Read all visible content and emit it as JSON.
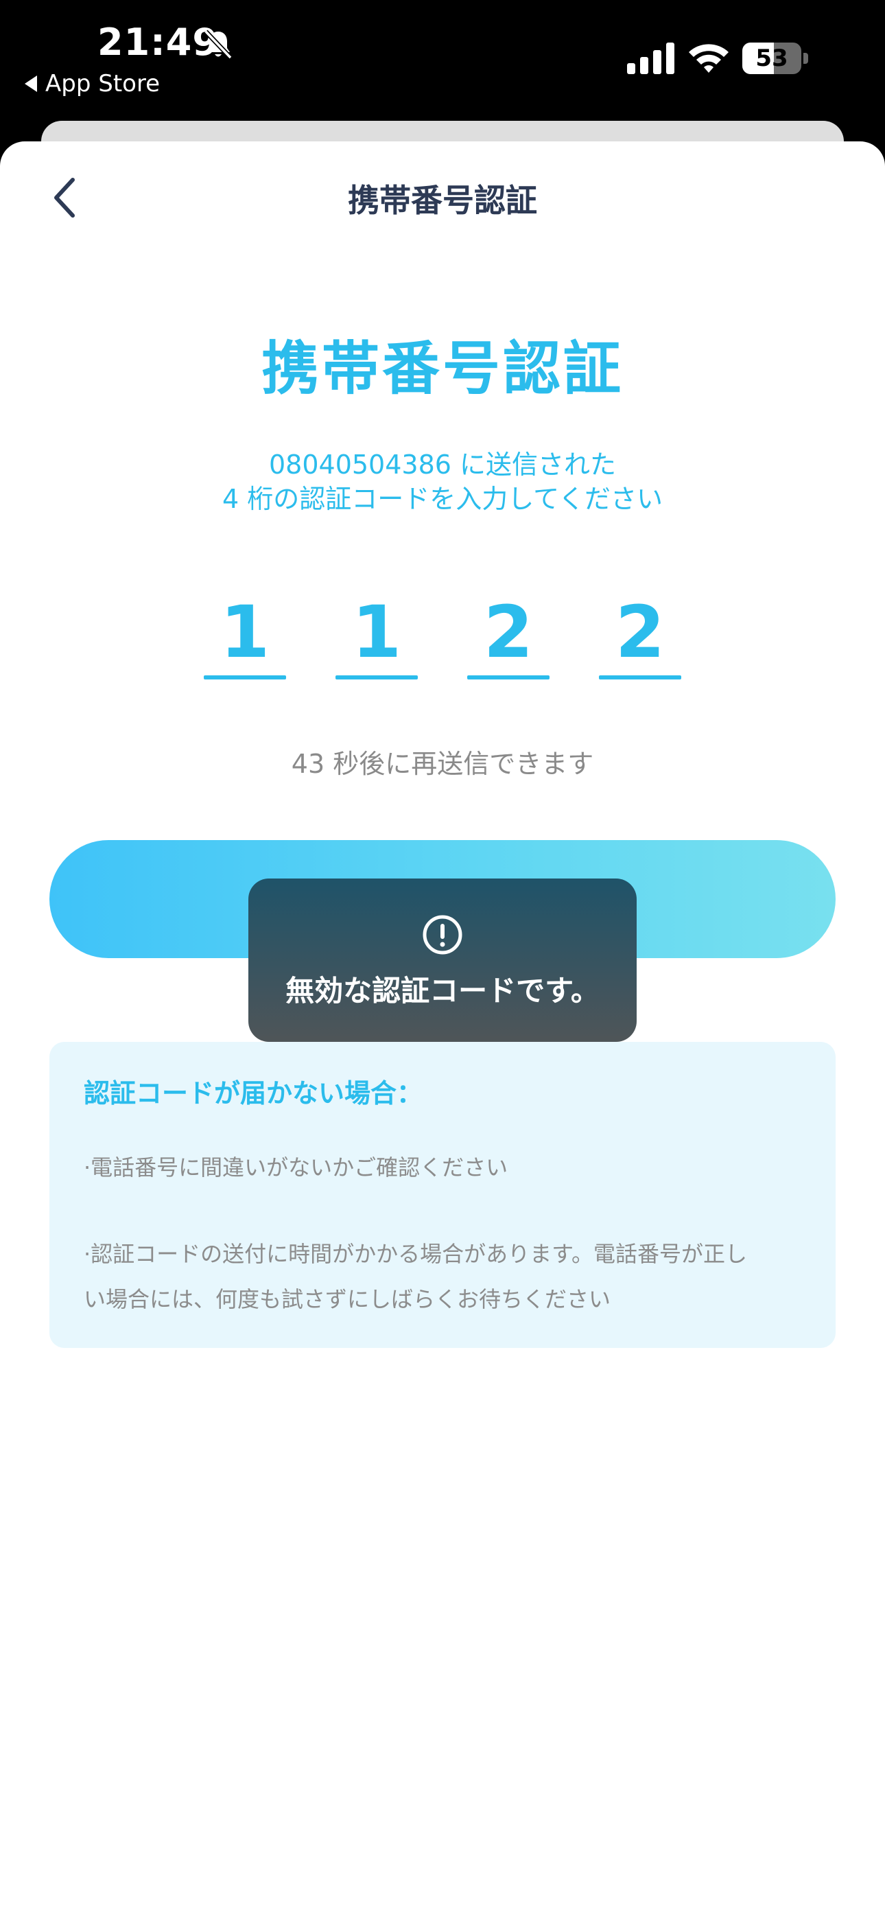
{
  "status_bar": {
    "time": "21:49",
    "back_app": "App Store",
    "battery": "53",
    "battery_level": 0.53
  },
  "nav": {
    "title": "携帯番号認証"
  },
  "main": {
    "title": "携帯番号認証",
    "subtitle_line1": "08040504386 に送信された",
    "subtitle_line2": "4 桁の認証コードを入力してください",
    "code_digits": [
      "1",
      "1",
      "2",
      "2"
    ],
    "resend_text": "43 秒後に再送信できます"
  },
  "toast": {
    "message": "無効な認証コードです。"
  },
  "help": {
    "title": "認証コードが届かない場合：",
    "item1": "·電話番号に間違いがないかご確認ください",
    "item2_line1": "·認証コードの送付に時間がかかる場合があります。電話番号が正し",
    "item2_line2": "い場合には、何度も試さずにしばらくお待ちください"
  },
  "colors": {
    "accent": "#2bbcec",
    "nav_text": "#2d3a55",
    "muted": "#8a8a8a"
  }
}
